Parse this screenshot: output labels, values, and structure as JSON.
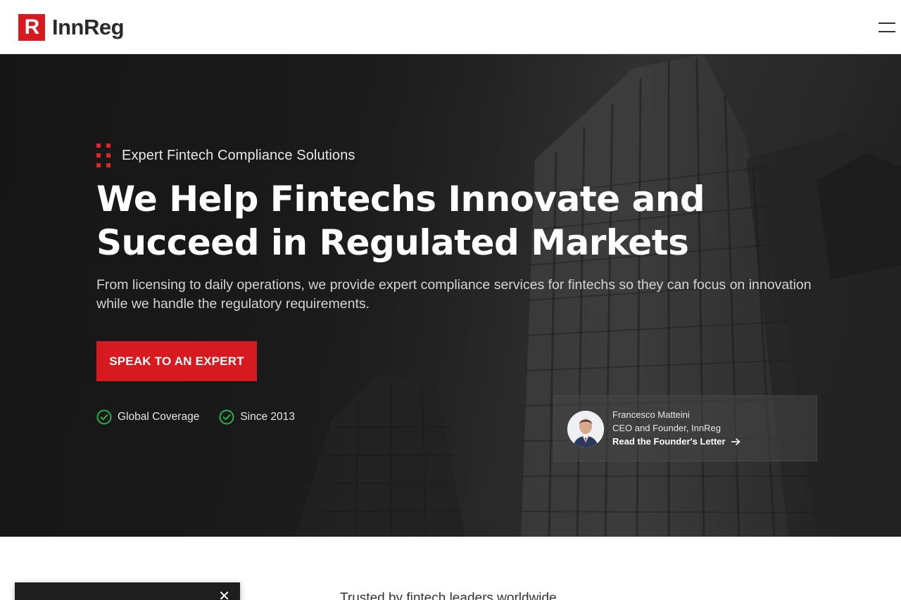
{
  "header": {
    "logo_letter": "R",
    "logo_text": "InnReg",
    "menu_icon": "hamburger-icon"
  },
  "hero": {
    "eyebrow": "Expert Fintech Compliance Solutions",
    "title": "We Help Fintechs Innovate and Succeed in Regulated Markets",
    "subtitle": "From licensing to daily operations, we provide expert compliance services for fintechs so they can focus on innovation while we handle the regulatory requirements.",
    "cta_label": "SPEAK TO AN EXPERT",
    "badges": [
      {
        "label": "Global Coverage",
        "icon": "check-circle-icon"
      },
      {
        "label": "Since 2013",
        "icon": "check-circle-icon"
      }
    ],
    "founder": {
      "name": "Francesco Matteini",
      "role": "CEO and Founder, InnReg",
      "link": "Read the Founder's Letter",
      "link_icon": "arrow-right-icon"
    }
  },
  "trusted_heading": "Trusted by fintech leaders worldwide",
  "popup": {
    "close_icon": "close-icon",
    "close_glyph": "✕"
  },
  "colors": {
    "brand_red": "#d71920",
    "check_green": "#2bb14a",
    "hero_dark": "#1c1c1c"
  }
}
